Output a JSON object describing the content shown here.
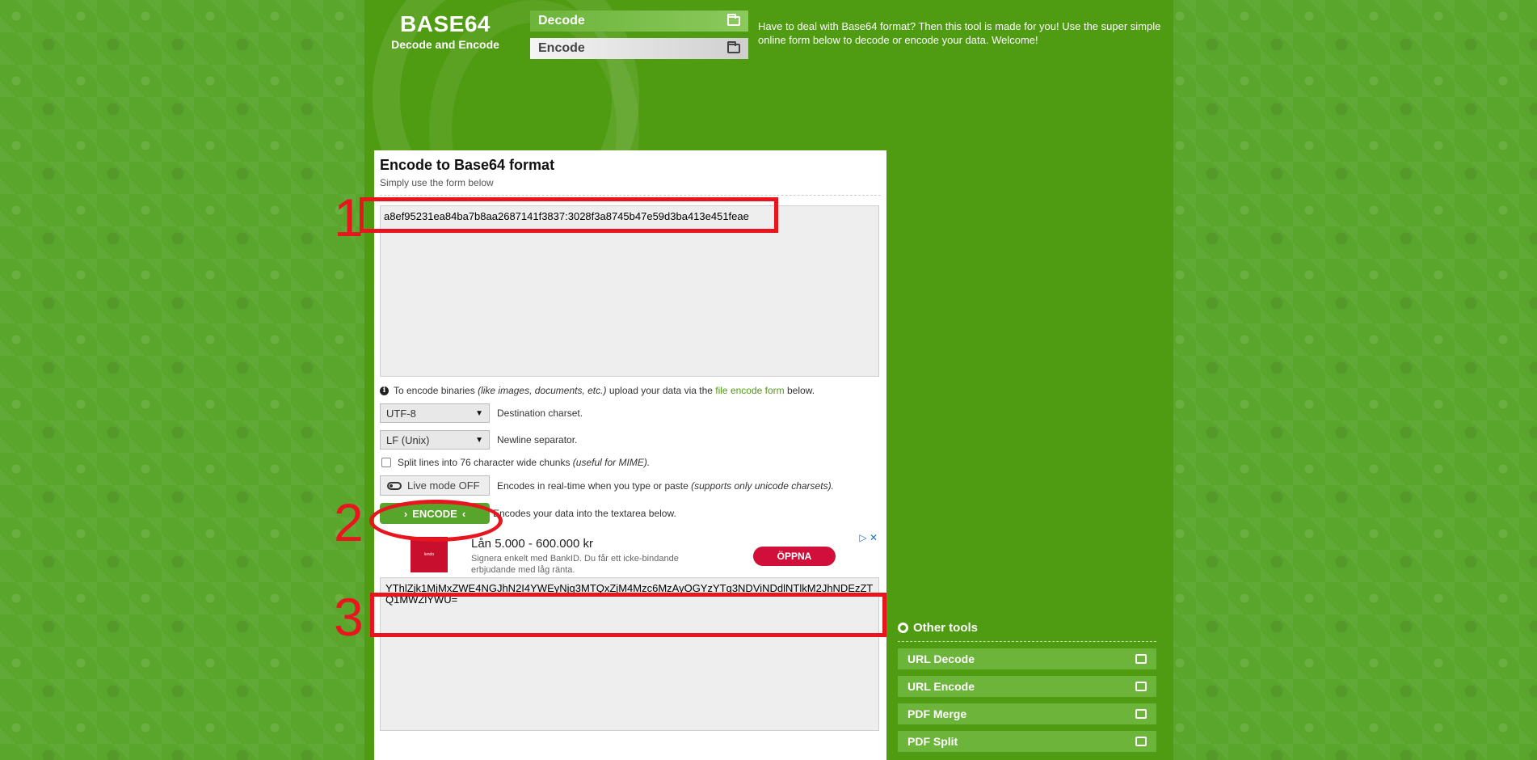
{
  "header": {
    "logo_title": "BASE64",
    "logo_subtitle": "Decode and Encode",
    "intro": "Have to deal with Base64 format? Then this tool is made for you! Use the super simple online form below to decode or encode your data. Welcome!",
    "nav": [
      {
        "label": "Decode",
        "icon": "folder-open-icon"
      },
      {
        "label": "Encode",
        "icon": "folder-icon"
      }
    ]
  },
  "main": {
    "title": "Encode to Base64 format",
    "subtitle": "Simply use the form below",
    "input_value": "a8ef95231ea84ba7b8aa2687141f3837:3028f3a8745b47e59d3ba413e451feae",
    "hint": {
      "prefix": "To encode binaries",
      "italic": "(like images, documents, etc.)",
      "middle": "upload your data via the",
      "link": "file encode form",
      "suffix": "below."
    },
    "charset": {
      "value": "UTF-8",
      "label": "Destination charset."
    },
    "newline": {
      "value": "LF (Unix)",
      "label": "Newline separator."
    },
    "split": {
      "label": "Split lines into 76 character wide chunks",
      "italic": "(useful for MIME)."
    },
    "live_mode": {
      "label": "Live mode OFF",
      "description": "Encodes in real-time when you type or paste",
      "italic": "(supports only unicode charsets)."
    },
    "encode": {
      "label": "ENCODE",
      "description": "Encodes your data into the textarea below."
    },
    "output_value": "YThlZjk1MjMxZWE4NGJhN2I4YWEyNjg3MTQxZjM4Mzc6MzAyOGYzYTg3NDViNDdlNTlkM2JhNDEzZTQ1MWZlYWU="
  },
  "ad": {
    "logo_text": "lendo",
    "title": "Lån 5.000 - 600.000 kr",
    "text": "Signera enkelt med BankID. Du får ett icke-bindande erbjudande med låg ränta.",
    "cta": "ÖPPNA",
    "close": "▷ ✕"
  },
  "annotations": {
    "one": "1",
    "two": "2",
    "three": "3"
  },
  "sidebar": {
    "title": "Other tools",
    "tools": [
      {
        "label": "URL Decode"
      },
      {
        "label": "URL Encode"
      },
      {
        "label": "PDF Merge"
      },
      {
        "label": "PDF Split"
      }
    ]
  },
  "colors": {
    "page_green": "#4f9b12",
    "button_green": "#57a52a",
    "annotation_red": "#e8141e"
  }
}
